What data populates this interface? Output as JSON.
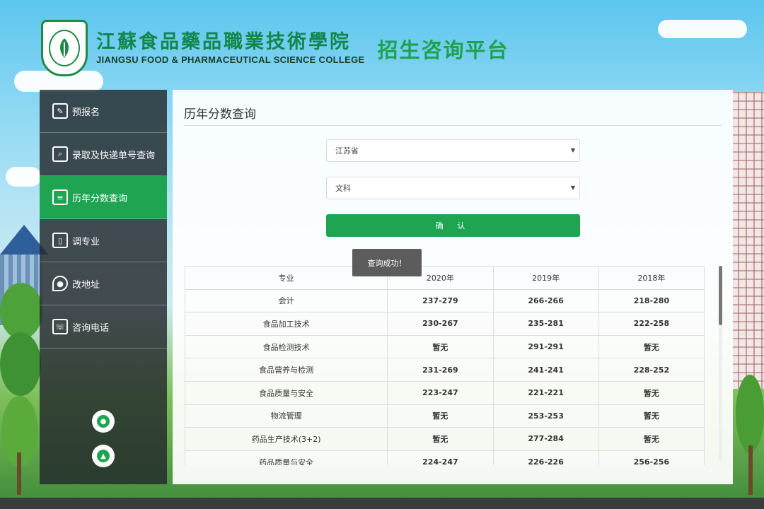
{
  "header": {
    "college_cn": "江蘇食品藥品職業技術學院",
    "college_en": "JIANGSU FOOD & PHARMACEUTICAL SCIENCE COLLEGE",
    "platform": "招生咨询平台"
  },
  "sidebar": {
    "items": [
      {
        "label": "预报名",
        "icon": "pre-register-icon",
        "active": false
      },
      {
        "label": "录取及快递单号查询",
        "icon": "search-doc-icon",
        "active": false
      },
      {
        "label": "历年分数查询",
        "icon": "score-doc-icon",
        "active": true
      },
      {
        "label": "调专业",
        "icon": "book-icon",
        "active": false
      },
      {
        "label": "改地址",
        "icon": "location-pin-icon",
        "active": false
      },
      {
        "label": "咨询电话",
        "icon": "phone-icon",
        "active": false
      }
    ],
    "buttons": [
      {
        "icon": "wechat-icon"
      },
      {
        "icon": "up-arrow-icon"
      }
    ]
  },
  "main": {
    "title": "历年分数查询",
    "province_select": {
      "value": "江苏省"
    },
    "subject_select": {
      "value": "文科"
    },
    "confirm_label": "确 认",
    "toast": "查询成功！",
    "table": {
      "headers": [
        "专业",
        "2020年",
        "2019年",
        "2018年"
      ],
      "rows": [
        [
          "会计",
          "237-279",
          "266-266",
          "218-280"
        ],
        [
          "食品加工技术",
          "230-267",
          "235-281",
          "222-258"
        ],
        [
          "食品检测技术",
          "暂无",
          "291-291",
          "暂无"
        ],
        [
          "食品营养与检测",
          "231-269",
          "241-241",
          "228-252"
        ],
        [
          "食品质量与安全",
          "223-247",
          "221-221",
          "暂无"
        ],
        [
          "物流管理",
          "暂无",
          "253-253",
          "暂无"
        ],
        [
          "药品生产技术(3+2)",
          "暂无",
          "277-284",
          "暂无"
        ],
        [
          "药品质量与安全",
          "224-247",
          "226-226",
          "256-256"
        ]
      ]
    }
  },
  "colors": {
    "accent": "#1fa552",
    "sky": "#5cc6ee",
    "sidebar_bg": "#23282c"
  }
}
